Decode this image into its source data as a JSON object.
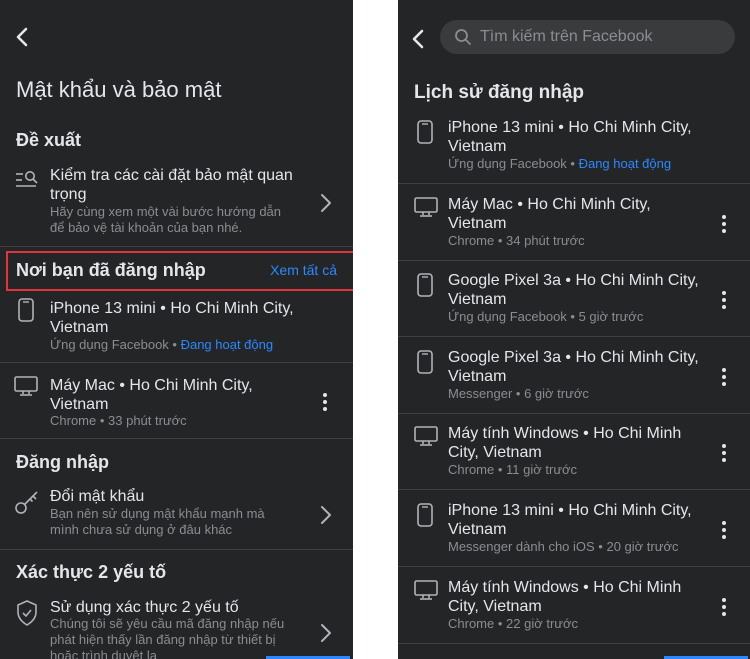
{
  "left": {
    "title": "Mật khẩu và bảo mật",
    "suggest": {
      "heading": "Đề xuất",
      "item_title": "Kiểm tra các cài đặt bảo mật quan trọng",
      "item_title_line1": "Kiểm tra các cài đặt bảo mật quan",
      "item_title_line2": "trọng",
      "item_desc_line1": "Hãy cùng xem một vài bước hướng dẫn",
      "item_desc_line2": "để bảo vệ tài khoản của bạn nhé."
    },
    "where": {
      "heading": "Nơi bạn đã đăng nhập",
      "see_all": "Xem tất cả",
      "sessions": [
        {
          "device_icon": "phone-icon",
          "line1": "iPhone 13 mini • Ho Chi Minh City,",
          "line2": "Vietnam",
          "meta": "Ứng dụng Facebook",
          "status": "Đang hoạt động"
        },
        {
          "device_icon": "desktop-icon",
          "line1": "Máy Mac • Ho Chi Minh City,",
          "line2": "Vietnam",
          "meta": "Chrome • 33 phút trước"
        }
      ]
    },
    "login": {
      "heading": "Đăng nhập",
      "change_password": "Đổi mật khẩu",
      "desc_line1": "Bạn nên sử dụng mật khẩu mạnh mà",
      "desc_line2": "mình chưa sử dụng ở đâu khác"
    },
    "twofa": {
      "heading": "Xác thực 2 yếu tố",
      "item_title": "Sử dụng xác thực 2 yếu tố",
      "desc_line1": "Chúng tôi sẽ yêu cầu mã đăng nhập nếu",
      "desc_line2": "phát hiện thấy lần đăng nhập từ thiết bị",
      "desc_line3": "hoặc trình duyệt lạ"
    }
  },
  "right": {
    "search": {
      "placeholder": "Tìm kiếm trên Facebook"
    },
    "title": "Lịch sử đăng nhập",
    "sessions": [
      {
        "device_icon": "phone-icon",
        "line1": "iPhone 13 mini • Ho Chi Minh City,",
        "line2": "Vietnam",
        "meta": "Ứng dụng Facebook",
        "status": "Đang hoạt động"
      },
      {
        "device_icon": "desktop-icon",
        "line1": "Máy Mac • Ho Chi Minh City,",
        "line2": "Vietnam",
        "meta": "Chrome • 34 phút trước"
      },
      {
        "device_icon": "phone-icon",
        "line1": "Google Pixel 3a • Ho Chi Minh City,",
        "line2": "Vietnam",
        "meta": "Ứng dụng Facebook • 5 giờ trước"
      },
      {
        "device_icon": "phone-icon",
        "line1": "Google Pixel 3a • Ho Chi Minh City,",
        "line2": "Vietnam",
        "meta": "Messenger • 6 giờ trước"
      },
      {
        "device_icon": "desktop-icon",
        "line1": "Máy tính Windows • Ho Chi Minh",
        "line2": "City, Vietnam",
        "meta": "Chrome • 11 giờ trước"
      },
      {
        "device_icon": "phone-icon",
        "line1": "iPhone 13 mini • Ho Chi Minh City,",
        "line2": "Vietnam",
        "meta": "Messenger dành cho iOS • 20 giờ trước"
      },
      {
        "device_icon": "desktop-icon",
        "line1": "Máy tính Windows • Ho Chi Minh",
        "line2": "City, Vietnam",
        "meta": "Chrome • 22 giờ trước"
      }
    ]
  },
  "colors": {
    "background": "#242526",
    "text": "#e4e6eb",
    "secondary": "#8a8d91",
    "accent": "#2d88ff",
    "highlight_border": "#e0353c",
    "separator": "#3e4042"
  }
}
